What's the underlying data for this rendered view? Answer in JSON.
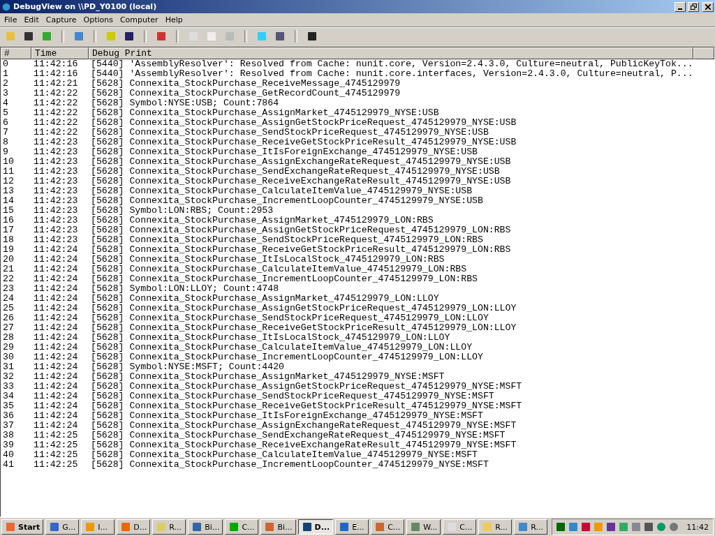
{
  "window": {
    "title": "DebugView on \\\\PD_Y0100 (local)"
  },
  "menu": [
    "File",
    "Edit",
    "Capture",
    "Options",
    "Computer",
    "Help"
  ],
  "table": {
    "columns": [
      "#",
      "Time",
      "Debug Print"
    ],
    "rows": [
      [
        "0",
        "11:42:16",
        "[5440] 'AssemblyResolver': Resolved from Cache: nunit.core, Version=2.4.3.0, Culture=neutral, PublicKeyTok..."
      ],
      [
        "1",
        "11:42:16",
        "[5440] 'AssemblyResolver': Resolved from Cache: nunit.core.interfaces, Version=2.4.3.0, Culture=neutral, P..."
      ],
      [
        "2",
        "11:42:21",
        "[5628] Connexita_StockPurchase_ReceiveMessage_4745129979"
      ],
      [
        "3",
        "11:42:22",
        "[5628] Connexita_StockPurchase_GetRecordCount_4745129979"
      ],
      [
        "4",
        "11:42:22",
        "[5628] Symbol:NYSE:USB; Count:7864"
      ],
      [
        "5",
        "11:42:22",
        "[5628] Connexita_StockPurchase_AssignMarket_4745129979_NYSE:USB"
      ],
      [
        "6",
        "11:42:22",
        "[5628] Connexita_StockPurchase_AssignGetStockPriceRequest_4745129979_NYSE:USB"
      ],
      [
        "7",
        "11:42:22",
        "[5628] Connexita_StockPurchase_SendStockPriceRequest_4745129979_NYSE:USB"
      ],
      [
        "8",
        "11:42:23",
        "[5628] Connexita_StockPurchase_ReceiveGetStockPriceResult_4745129979_NYSE:USB"
      ],
      [
        "9",
        "11:42:23",
        "[5628] Connexita_StockPurchase_ItIsForeignExchange_4745129979_NYSE:USB"
      ],
      [
        "10",
        "11:42:23",
        "[5628] Connexita_StockPurchase_AssignExchangeRateRequest_4745129979_NYSE:USB"
      ],
      [
        "11",
        "11:42:23",
        "[5628] Connexita_StockPurchase_SendExchangeRateRequest_4745129979_NYSE:USB"
      ],
      [
        "12",
        "11:42:23",
        "[5628] Connexita_StockPurchase_ReceiveExchangeRateResult_4745129979_NYSE:USB"
      ],
      [
        "13",
        "11:42:23",
        "[5628] Connexita_StockPurchase_CalculateItemValue_4745129979_NYSE:USB"
      ],
      [
        "14",
        "11:42:23",
        "[5628] Connexita_StockPurchase_IncrementLoopCounter_4745129979_NYSE:USB"
      ],
      [
        "15",
        "11:42:23",
        "[5628] Symbol:LON:RBS; Count:2953"
      ],
      [
        "16",
        "11:42:23",
        "[5628] Connexita_StockPurchase_AssignMarket_4745129979_LON:RBS"
      ],
      [
        "17",
        "11:42:23",
        "[5628] Connexita_StockPurchase_AssignGetStockPriceRequest_4745129979_LON:RBS"
      ],
      [
        "18",
        "11:42:23",
        "[5628] Connexita_StockPurchase_SendStockPriceRequest_4745129979_LON:RBS"
      ],
      [
        "19",
        "11:42:24",
        "[5628] Connexita_StockPurchase_ReceiveGetStockPriceResult_4745129979_LON:RBS"
      ],
      [
        "20",
        "11:42:24",
        "[5628] Connexita_StockPurchase_ItIsLocalStock_4745129979_LON:RBS"
      ],
      [
        "21",
        "11:42:24",
        "[5628] Connexita_StockPurchase_CalculateItemValue_4745129979_LON:RBS"
      ],
      [
        "22",
        "11:42:24",
        "[5628] Connexita_StockPurchase_IncrementLoopCounter_4745129979_LON:RBS"
      ],
      [
        "23",
        "11:42:24",
        "[5628] Symbol:LON:LLOY; Count:4748"
      ],
      [
        "24",
        "11:42:24",
        "[5628] Connexita_StockPurchase_AssignMarket_4745129979_LON:LLOY"
      ],
      [
        "25",
        "11:42:24",
        "[5628] Connexita_StockPurchase_AssignGetStockPriceRequest_4745129979_LON:LLOY"
      ],
      [
        "26",
        "11:42:24",
        "[5628] Connexita_StockPurchase_SendStockPriceRequest_4745129979_LON:LLOY"
      ],
      [
        "27",
        "11:42:24",
        "[5628] Connexita_StockPurchase_ReceiveGetStockPriceResult_4745129979_LON:LLOY"
      ],
      [
        "28",
        "11:42:24",
        "[5628] Connexita_StockPurchase_ItIsLocalStock_4745129979_LON:LLOY"
      ],
      [
        "29",
        "11:42:24",
        "[5628] Connexita_StockPurchase_CalculateItemValue_4745129979_LON:LLOY"
      ],
      [
        "30",
        "11:42:24",
        "[5628] Connexita_StockPurchase_IncrementLoopCounter_4745129979_LON:LLOY"
      ],
      [
        "31",
        "11:42:24",
        "[5628] Symbol:NYSE:MSFT; Count:4420"
      ],
      [
        "32",
        "11:42:24",
        "[5628] Connexita_StockPurchase_AssignMarket_4745129979_NYSE:MSFT"
      ],
      [
        "33",
        "11:42:24",
        "[5628] Connexita_StockPurchase_AssignGetStockPriceRequest_4745129979_NYSE:MSFT"
      ],
      [
        "34",
        "11:42:24",
        "[5628] Connexita_StockPurchase_SendStockPriceRequest_4745129979_NYSE:MSFT"
      ],
      [
        "35",
        "11:42:24",
        "[5628] Connexita_StockPurchase_ReceiveGetStockPriceResult_4745129979_NYSE:MSFT"
      ],
      [
        "36",
        "11:42:24",
        "[5628] Connexita_StockPurchase_ItIsForeignExchange_4745129979_NYSE:MSFT"
      ],
      [
        "37",
        "11:42:24",
        "[5628] Connexita_StockPurchase_AssignExchangeRateRequest_4745129979_NYSE:MSFT"
      ],
      [
        "38",
        "11:42:25",
        "[5628] Connexita_StockPurchase_SendExchangeRateRequest_4745129979_NYSE:MSFT"
      ],
      [
        "39",
        "11:42:25",
        "[5628] Connexita_StockPurchase_ReceiveExchangeRateResult_4745129979_NYSE:MSFT"
      ],
      [
        "40",
        "11:42:25",
        "[5628] Connexita_StockPurchase_CalculateItemValue_4745129979_NYSE:MSFT"
      ],
      [
        "41",
        "11:42:25",
        "[5628] Connexita_StockPurchase_IncrementLoopCounter_4745129979_NYSE:MSFT"
      ]
    ]
  },
  "taskbar": {
    "start": "Start",
    "clock": "11:42",
    "items": [
      {
        "label": "G...",
        "selected": false
      },
      {
        "label": "I...",
        "selected": false
      },
      {
        "label": "D...",
        "selected": false
      },
      {
        "label": "R...",
        "selected": false
      },
      {
        "label": "Bi...",
        "selected": false
      },
      {
        "label": "C...",
        "selected": false
      },
      {
        "label": "Bi...",
        "selected": false
      },
      {
        "label": "D...",
        "selected": true
      },
      {
        "label": "E...",
        "selected": false
      },
      {
        "label": "C...",
        "selected": false
      },
      {
        "label": "W...",
        "selected": false
      },
      {
        "label": "C...",
        "selected": false
      },
      {
        "label": "R...",
        "selected": false
      },
      {
        "label": "R...",
        "selected": false
      }
    ]
  }
}
